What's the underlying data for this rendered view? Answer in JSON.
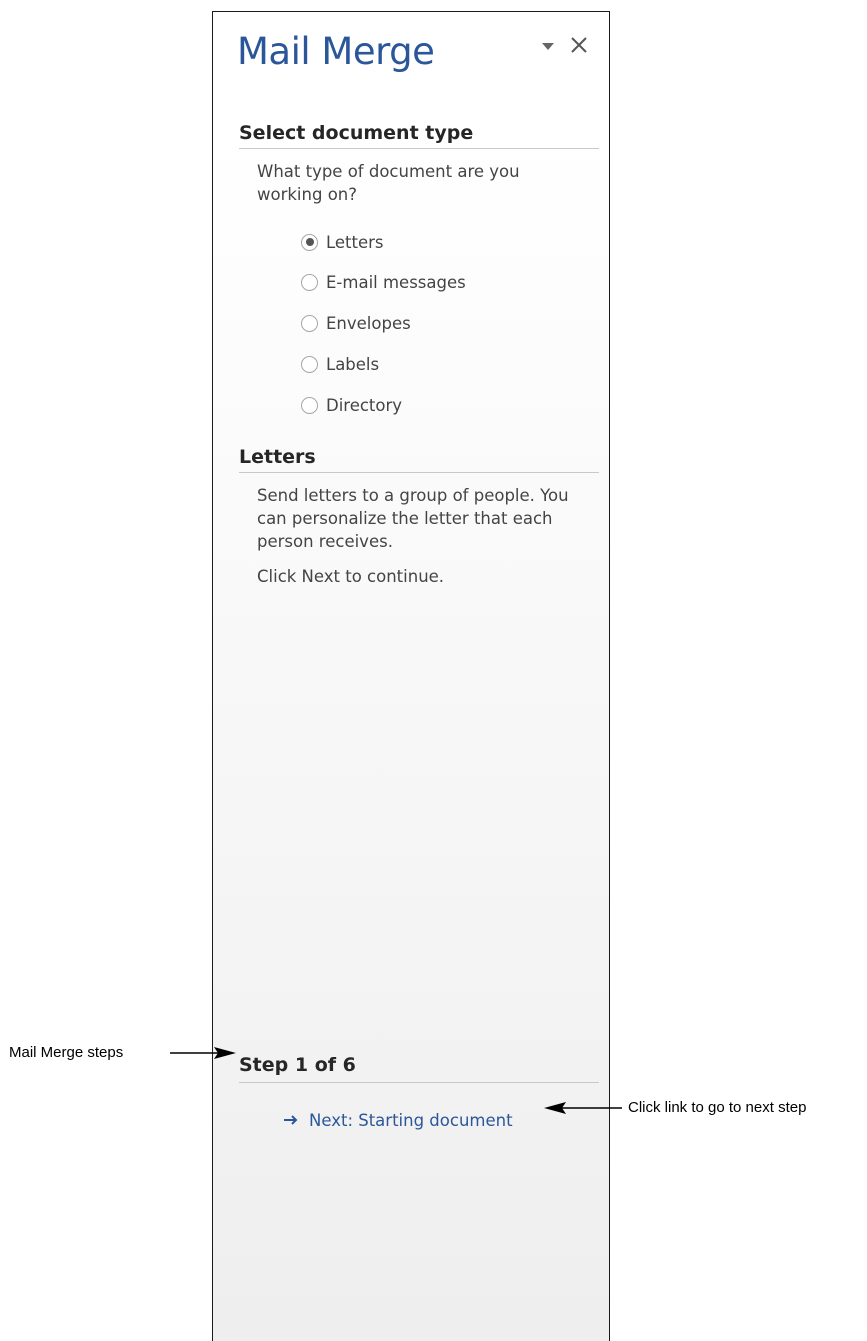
{
  "pane": {
    "title": "Mail Merge",
    "menu_icon": "dropdown-triangle-icon",
    "close_icon": "close-icon"
  },
  "select_type": {
    "heading": "Select document type",
    "question": "What type of document are you working on?",
    "options": [
      {
        "label": "Letters",
        "checked": true
      },
      {
        "label": "E-mail messages",
        "checked": false
      },
      {
        "label": "Envelopes",
        "checked": false
      },
      {
        "label": "Labels",
        "checked": false
      },
      {
        "label": "Directory",
        "checked": false
      }
    ]
  },
  "letters": {
    "heading": "Letters",
    "description": "Send letters to a group of people. You can personalize the letter that each person receives.",
    "instruction": "Click Next to continue."
  },
  "step": {
    "heading": "Step 1 of 6",
    "next_link": "Next: Starting document",
    "next_icon": "right-arrow-icon"
  },
  "callouts": {
    "steps_label": "Mail Merge steps",
    "next_label": "Click link to go to next step"
  },
  "colors": {
    "title": "#2b579a",
    "link": "#2b579a",
    "border": "#1a1a1a"
  }
}
